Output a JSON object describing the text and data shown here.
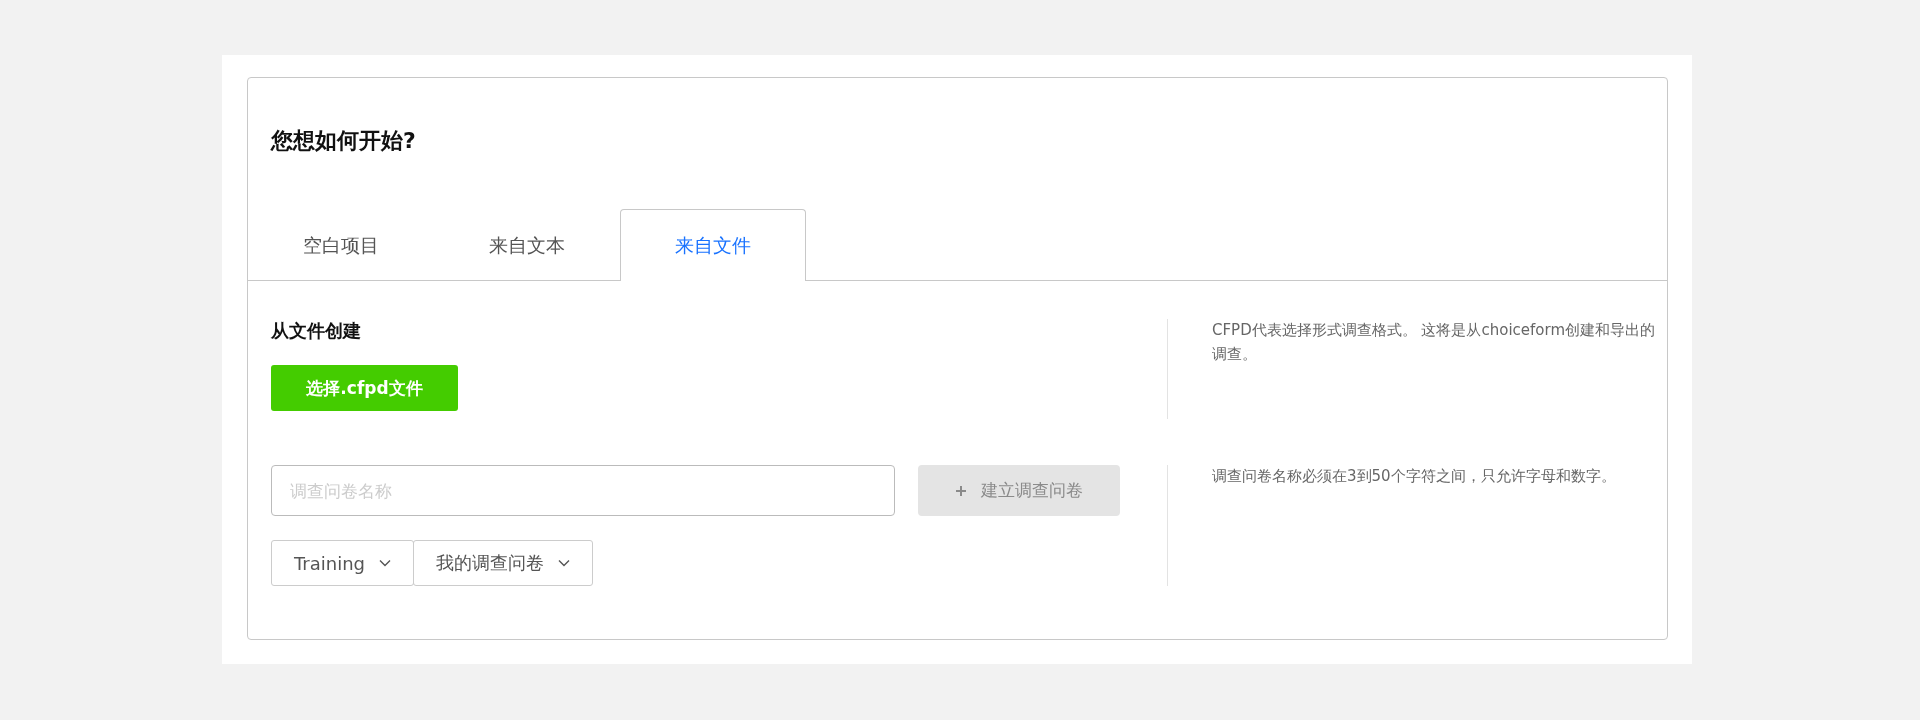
{
  "title": "您想如何开始?",
  "tabs": [
    {
      "label": "空白项目",
      "selected": false
    },
    {
      "label": "来自文本",
      "selected": false
    },
    {
      "label": "来自文件",
      "selected": true
    }
  ],
  "section_title": "从文件创建",
  "choose_file_button": "选择.cfpd文件",
  "file_help": "CFPD代表选择形式调查格式。 这将是从choiceform创建和导出的调查。",
  "name_field": {
    "placeholder": "调查问卷名称"
  },
  "create_button": {
    "label": "建立调查问卷",
    "disabled": true
  },
  "name_help": "调查问卷名称必须在3到50个字符之间，只允许字母和数字。",
  "dropdowns": [
    {
      "label": "Training"
    },
    {
      "label": "我的调查问卷"
    }
  ]
}
